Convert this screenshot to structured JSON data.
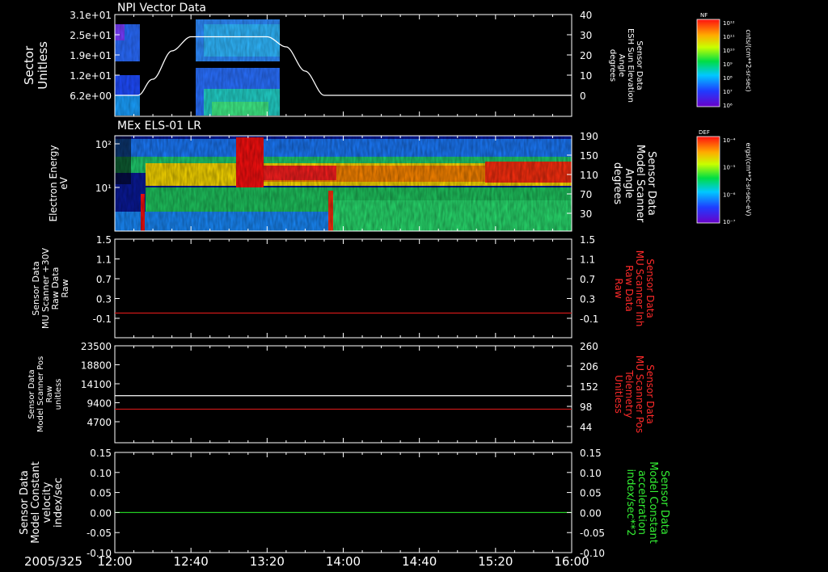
{
  "date_label": "2005/325",
  "x_ticks": [
    "12:00",
    "12:40",
    "13:20",
    "14:00",
    "14:40",
    "15:20",
    "16:00"
  ],
  "chart_data": [
    {
      "type": "heatmap",
      "title": "NPI Vector Data",
      "ylabel": [
        "Sector",
        "Unitless"
      ],
      "y_ticks": [
        "3.1e+01",
        "2.5e+01",
        "1.9e+01",
        "1.2e+01",
        "6.2e+00"
      ],
      "right_ylabel": [
        "Sensor Data",
        "ESH Sun Elevation",
        "Angle",
        "degrees"
      ],
      "right_ticks": [
        "40",
        "30",
        "20",
        "10",
        "0"
      ],
      "right_ylim": [
        -10,
        40
      ],
      "overlay_line": {
        "name": "ESH Sun Elevation Angle",
        "color": "#ffffff",
        "x": [
          "12:00",
          "12:12",
          "12:20",
          "12:30",
          "12:40",
          "13:20",
          "13:30",
          "13:40",
          "13:50",
          "16:00"
        ],
        "y": [
          0,
          0,
          8,
          22,
          29,
          29,
          24,
          12,
          0,
          0
        ]
      },
      "colorbar": {
        "label_top": "NF",
        "unit": "cnts/(cm**2-sr-sec)",
        "ticks": [
          "10¹²",
          "10¹¹",
          "10¹⁰",
          "10⁹",
          "10⁸",
          "10⁷",
          "10⁶"
        ]
      }
    },
    {
      "type": "heatmap",
      "title": "MEx ELS-01 LR",
      "ylabel": [
        "Electron Energy",
        "eV"
      ],
      "y_ticks": [
        "10²",
        "10¹"
      ],
      "right_ylabel": [
        "Sensor Data",
        "Model Scanner",
        "Angle",
        "degrees"
      ],
      "right_ticks": [
        "190",
        "150",
        "110",
        "70",
        "30"
      ],
      "colorbar": {
        "label_top": "DEF",
        "unit": "ergs/(cm**2-sr-sec-eV)",
        "ticks": [
          "10⁻⁴",
          "10⁻⁵",
          "10⁻⁶",
          "10⁻⁷"
        ]
      }
    },
    {
      "type": "line",
      "ylabel": [
        "Sensor Data",
        "MU Scanner +30V",
        "Raw Data",
        "Raw"
      ],
      "y_ticks": [
        "1.5",
        "1.1",
        "0.7",
        "0.3",
        "-0.1"
      ],
      "ylim": [
        -0.5,
        1.5
      ],
      "right_ylabel": [
        "Sensor Data",
        "MU Scanner Inh",
        "Raw Data",
        "Raw"
      ],
      "right_ylabel_color": "#ff2a2a",
      "right_ticks": [
        "1.5",
        "1.1",
        "0.7",
        "0.3",
        "-0.1"
      ],
      "series": [
        {
          "color": "#d01818",
          "x": [
            "12:00",
            "16:00"
          ],
          "y": [
            0.0,
            0.0
          ]
        }
      ]
    },
    {
      "type": "line",
      "ylabel": [
        "Sensor Data",
        "Model Scanner Pos",
        "Raw",
        "unitless"
      ],
      "y_ticks": [
        "23500",
        "18800",
        "14100",
        "9400",
        "4700"
      ],
      "ylim": [
        0,
        23500
      ],
      "right_ylabel": [
        "Sensor Data",
        "MU Scanner Pos",
        "Telemetry",
        "Unitless"
      ],
      "right_ylabel_color": "#ff2a2a",
      "right_ticks": [
        "260",
        "206",
        "152",
        "98",
        "44"
      ],
      "right_ylim": [
        0,
        260
      ],
      "series": [
        {
          "color": "#ffffff",
          "axis": "left",
          "x": [
            "12:00",
            "16:00"
          ],
          "y": [
            11400,
            11400
          ]
        },
        {
          "color": "#d01818",
          "axis": "right",
          "x": [
            "12:00",
            "16:00"
          ],
          "y": [
            90,
            90
          ]
        }
      ]
    },
    {
      "type": "line",
      "ylabel": [
        "Sensor Data",
        "Model Constant",
        "velocity",
        "index/sec"
      ],
      "y_ticks": [
        "0.15",
        "0.10",
        "0.05",
        "0.00",
        "-0.05",
        "-0.10"
      ],
      "ylim": [
        -0.1,
        0.15
      ],
      "right_ylabel": [
        "Sensor Data",
        "Model Constant",
        "acceleration",
        "index/sec**2"
      ],
      "right_ylabel_color": "#33ee33",
      "right_ticks": [
        "0.15",
        "0.10",
        "0.05",
        "0.00",
        "-0.05",
        "-0.10"
      ],
      "series": [
        {
          "color": "#22cc22",
          "x": [
            "12:00",
            "16:00"
          ],
          "y": [
            0.0,
            0.0
          ]
        }
      ]
    }
  ]
}
